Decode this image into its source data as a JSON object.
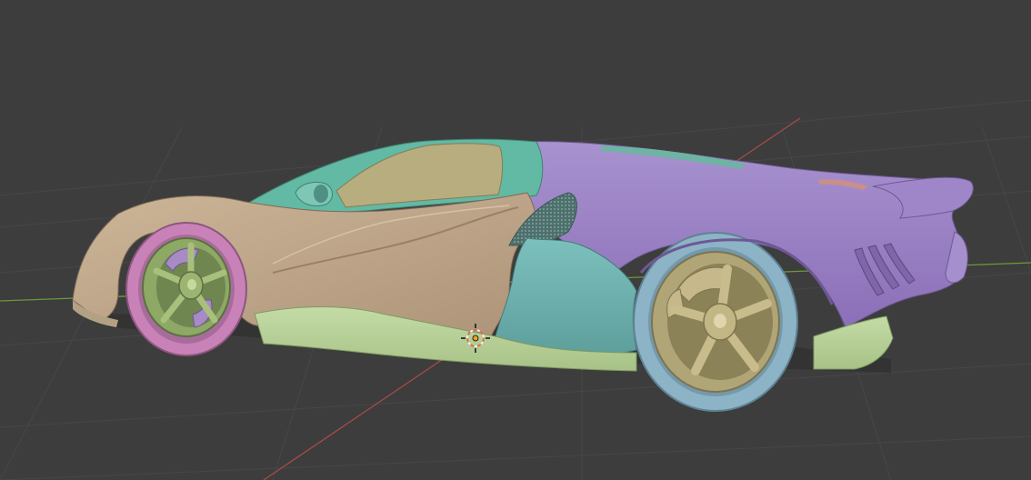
{
  "viewport": {
    "background": "#3d3d3d",
    "grid_color": "#474747",
    "x_axis_color": "#a84a4a",
    "y_axis_color": "#6a9a3a"
  },
  "model": {
    "panel_colors": {
      "front_clay": "#c2a98c",
      "cockpit_green": "#62b9a4",
      "canopy_tan": "#b8ad7e",
      "rear_purple": "#9b7fc4",
      "side_teal": "#6fb4b1",
      "sill_lime": "#b9d19a",
      "rear_tire_blue": "#8cb3c6",
      "front_tire_pink": "#c982b8",
      "front_rim_green": "#8ea865",
      "rear_rim_olive": "#b0a576",
      "brake_caliper_purple": "#a88bc4"
    }
  },
  "gizmos": {
    "origin_cursor": "3d-cursor-icon"
  }
}
